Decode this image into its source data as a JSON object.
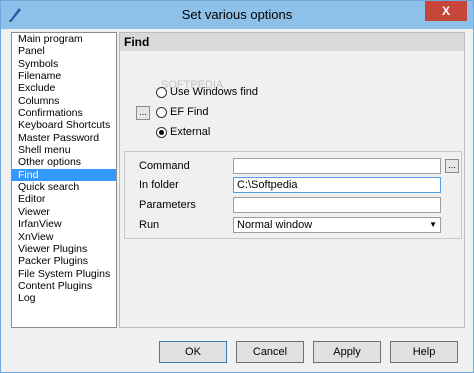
{
  "window": {
    "title": "Set various options",
    "close_label": "X"
  },
  "sidebar": {
    "items": [
      {
        "label": "Main program"
      },
      {
        "label": "Panel"
      },
      {
        "label": "Symbols"
      },
      {
        "label": "Filename"
      },
      {
        "label": "Exclude"
      },
      {
        "label": "Columns"
      },
      {
        "label": "Confirmations"
      },
      {
        "label": "Keyboard Shortcuts"
      },
      {
        "label": "Master Password"
      },
      {
        "label": "Shell menu"
      },
      {
        "label": "Other options"
      },
      {
        "label": "Find",
        "selected": true
      },
      {
        "label": "Quick search"
      },
      {
        "label": "Editor"
      },
      {
        "label": "Viewer"
      },
      {
        "label": "IrfanView"
      },
      {
        "label": "XnView"
      },
      {
        "label": "Viewer Plugins"
      },
      {
        "label": "Packer Plugins"
      },
      {
        "label": "File System Plugins"
      },
      {
        "label": "Content Plugins"
      },
      {
        "label": "Log"
      }
    ]
  },
  "panel": {
    "header": "Find",
    "radios": {
      "use_windows_find": "Use Windows find",
      "ef_find": "EF Find",
      "external": "External"
    },
    "browse_label": "...",
    "fields": {
      "command_label": "Command",
      "command_value": "",
      "in_folder_label": "In folder",
      "in_folder_value": "C:\\Softpedia",
      "parameters_label": "Parameters",
      "parameters_value": "",
      "run_label": "Run",
      "run_value": "Normal window"
    }
  },
  "buttons": {
    "ok": "OK",
    "cancel": "Cancel",
    "apply": "Apply",
    "help": "Help"
  }
}
